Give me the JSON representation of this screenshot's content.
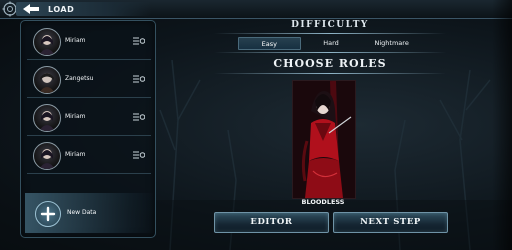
{
  "header": {
    "title": "LOAD"
  },
  "saves": [
    {
      "name": "Miriam"
    },
    {
      "name": "Zangetsu"
    },
    {
      "name": "Miriam"
    },
    {
      "name": "Miriam"
    }
  ],
  "new_data": {
    "label": "New Data"
  },
  "difficulty": {
    "title": "DIFFICULTY",
    "options": [
      "Easy",
      "Hard",
      "Nightmare"
    ],
    "selected": "Easy"
  },
  "roles": {
    "title": "CHOOSE ROLES",
    "selected_name": "BLOODLESS"
  },
  "buttons": {
    "editor": "EDITOR",
    "next_step": "NEXT STEP"
  },
  "colors": {
    "accent": "#6f93a6",
    "panel_border": "#34505f",
    "role_red": "#b0101c"
  }
}
